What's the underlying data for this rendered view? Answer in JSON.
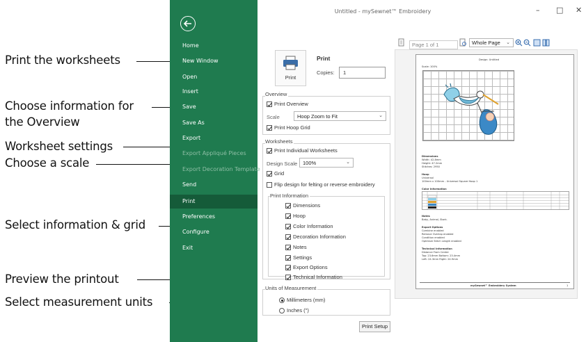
{
  "callouts": {
    "print_worksheets": "Print the worksheets",
    "overview_info_1": "Choose information for",
    "overview_info_2": "the Overview",
    "worksheet_settings": "Worksheet settings",
    "choose_scale": "Choose a scale",
    "select_info_grid": "Select information & grid",
    "preview_printout": "Preview the printout",
    "select_units": "Select measurement units"
  },
  "window": {
    "title": "Untitled - mySewnet™ Embroidery",
    "minimize": "–",
    "maximize": "□",
    "close": "✕"
  },
  "sidebar": {
    "back_icon": "back-arrow-icon",
    "items": [
      {
        "label": "Home",
        "disabled": false
      },
      {
        "label": "New Window",
        "disabled": false
      },
      {
        "label": "Open",
        "disabled": false
      },
      {
        "label": "Insert",
        "disabled": false
      },
      {
        "label": "Save",
        "disabled": false
      },
      {
        "label": "Save As",
        "disabled": false
      },
      {
        "label": "Export",
        "disabled": false
      },
      {
        "label": "Export Appliqué Pieces",
        "disabled": true
      },
      {
        "label": "Export Decoration Template",
        "disabled": true
      },
      {
        "label": "Send",
        "disabled": false
      },
      {
        "label": "Print",
        "disabled": false,
        "selected": true
      },
      {
        "label": "Preferences",
        "disabled": false
      },
      {
        "label": "Configure",
        "disabled": false
      },
      {
        "label": "Exit",
        "disabled": false
      }
    ]
  },
  "print": {
    "button_label": "Print",
    "heading": "Print",
    "copies_label": "Copies:",
    "copies_value": "1"
  },
  "overview": {
    "group_title": "Overview",
    "print_overview": "Print Overview",
    "scale_label": "Scale",
    "scale_value": "Hoop Zoom to Fit",
    "print_hoop_grid": "Print Hoop Grid"
  },
  "worksheets": {
    "group_title": "Worksheets",
    "print_individual": "Print Individual Worksheets",
    "design_scale_label": "Design Scale",
    "design_scale_value": "100%",
    "grid": "Grid",
    "flip": "Flip design for felting or reverse embroidery",
    "print_info_title": "Print Information",
    "info_items": [
      "Dimensions",
      "Hoop",
      "Color Information",
      "Decoration Information",
      "Notes",
      "Settings",
      "Export Options",
      "Technical Information"
    ]
  },
  "units": {
    "group_title": "Units of Measurement",
    "mm": "Millimeters (mm)",
    "inches": "Inches (\")"
  },
  "print_setup": "Print Setup",
  "preview": {
    "page_of": "Page 1 of 1",
    "zoom_value": "Whole Page",
    "page_title": "Design: Untitled",
    "scale": "Scale: 100%",
    "dimensions_head": "Dimensions",
    "width": "Width:  42.8mm",
    "height": "Height:  47.2mm",
    "stitches": "Stitches:  2950",
    "hoop_head": "Hoop",
    "hoop_type": "Universal",
    "hoop_desc": "100mm x 100mm - Universal Square Hoop 1",
    "color_head": "Color Information",
    "notes_head": "Notes",
    "notes": "Baby, Animal, Stork.",
    "export_head": "Export Options",
    "export_lines": [
      "Combine enabled",
      "Remove Overlap enabled",
      "Condition enabled",
      "Optimize Stitch Length enabled"
    ],
    "tech_head": "Technical Information",
    "tech_lines": [
      "Distance From Center",
      "Top:  23.6mm          Bottom:  23.4mm",
      "Left:  24.3mm          Right:  24.9mm"
    ],
    "footer": "mySewnet™ Embroidery System",
    "page_num": "1"
  }
}
